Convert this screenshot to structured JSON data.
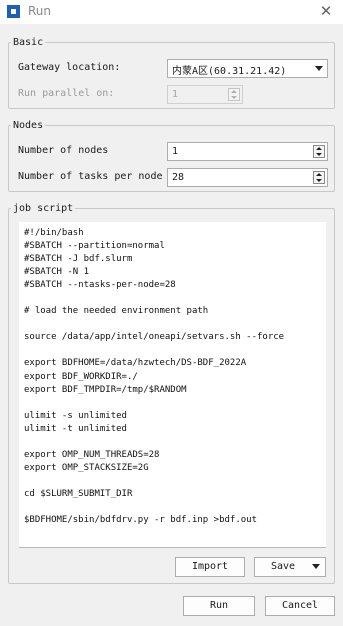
{
  "window": {
    "title": "Run",
    "close_glyph": "✕"
  },
  "basic": {
    "legend": "Basic",
    "gateway_label": "Gateway location:",
    "gateway_value": "内蒙A区(60.31.21.42)",
    "parallel_label": "Run parallel on:",
    "parallel_value": "1"
  },
  "nodes": {
    "legend": "Nodes",
    "num_nodes_label": "Number of nodes",
    "num_nodes_value": "1",
    "tasks_label": "Number of tasks per node",
    "tasks_value": "28"
  },
  "job": {
    "legend": "job script",
    "script": "#!/bin/bash\n#SBATCH --partition=normal\n#SBATCH -J bdf.slurm\n#SBATCH -N 1\n#SBATCH --ntasks-per-node=28\n\n# load the needed environment path\n\nsource /data/app/intel/oneapi/setvars.sh --force\n\nexport BDFHOME=/data/hzwtech/DS-BDF_2022A\nexport BDF_WORKDIR=./\nexport BDF_TMPDIR=/tmp/$RANDOM\n\nulimit -s unlimited\nulimit -t unlimited\n\nexport OMP_NUM_THREADS=28\nexport OMP_STACKSIZE=2G\n\ncd $SLURM_SUBMIT_DIR\n\n$BDFHOME/sbin/bdfdrv.py -r bdf.inp >bdf.out"
  },
  "buttons": {
    "import": "Import",
    "save": "Save",
    "run": "Run",
    "cancel": "Cancel"
  },
  "colors": {
    "title_icon": "#1f5fb8",
    "background": "#f0f0f0"
  }
}
